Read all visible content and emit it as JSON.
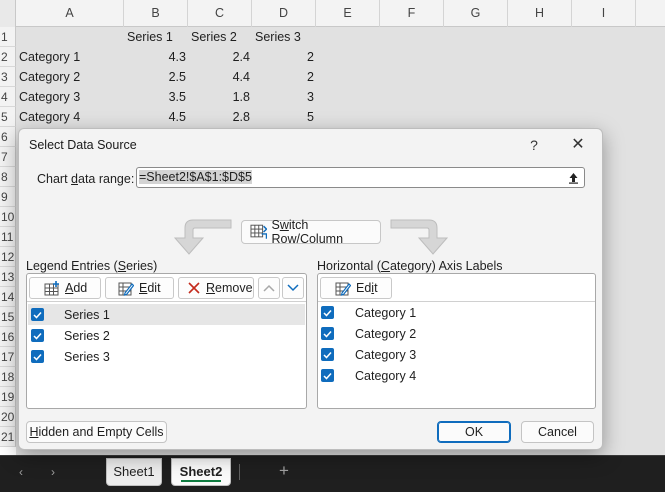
{
  "sheet": {
    "columns": [
      "A",
      "B",
      "C",
      "D",
      "E",
      "F",
      "G",
      "H",
      "I"
    ],
    "rows": [
      "1",
      "2",
      "3",
      "4",
      "5",
      "6",
      "7",
      "8",
      "9",
      "10",
      "11",
      "12",
      "13",
      "14",
      "15",
      "16",
      "17",
      "18",
      "19",
      "20",
      "21"
    ],
    "header_row": [
      "",
      "Series 1",
      "Series 2",
      "Series 3"
    ],
    "data": [
      [
        "Category 1",
        "4.3",
        "2.4",
        "2"
      ],
      [
        "Category 2",
        "2.5",
        "4.4",
        "2"
      ],
      [
        "Category 3",
        "3.5",
        "1.8",
        "3"
      ],
      [
        "Category 4",
        "4.5",
        "2.8",
        "5"
      ]
    ]
  },
  "tabs": {
    "prev": "‹",
    "next": "›",
    "sheet1": "Sheet1",
    "sheet2": "Sheet2",
    "add": "+"
  },
  "dialog": {
    "title": "Select Data Source",
    "help": "?",
    "close": "✕",
    "range_label_pre": "Chart ",
    "range_label_ul": "d",
    "range_label_post": "ata range:",
    "range_value": "=Sheet2!$A$1:$D$5",
    "switch_pre": "S",
    "switch_ul": "w",
    "switch_post": "itch Row/Column",
    "legend_label_pre": "Legend Entries (",
    "legend_label_ul": "S",
    "legend_label_post": "eries)",
    "axis_label_pre": "Horizontal (",
    "axis_label_ul": "C",
    "axis_label_post": "ategory) Axis Labels",
    "add_ul": "A",
    "add_post": "dd",
    "edit_pre": "",
    "edit_ul": "E",
    "edit_post": "dit",
    "remove_ul": "R",
    "remove_post": "emove",
    "axis_edit_pre": "Ed",
    "axis_edit_ul": "i",
    "axis_edit_post": "t",
    "series": [
      "Series 1",
      "Series 2",
      "Series 3"
    ],
    "categories": [
      "Category 1",
      "Category 2",
      "Category 3",
      "Category 4"
    ],
    "hidden_pre": "",
    "hidden_ul": "H",
    "hidden_post": "idden and Empty Cells",
    "ok": "OK",
    "cancel": "Cancel"
  },
  "colors": {
    "accent": "#0f6cbd",
    "sheet_tab_underline": "#107c41",
    "dialog_bg": "#f3f3f3",
    "remove_x": "#c42b1c"
  }
}
